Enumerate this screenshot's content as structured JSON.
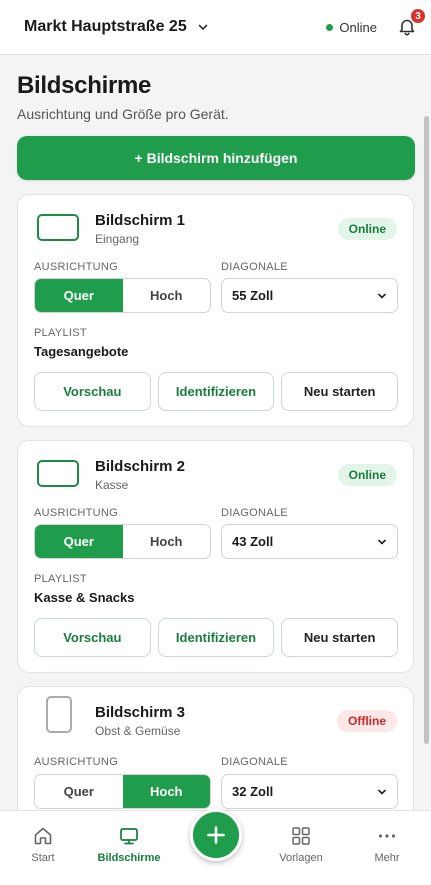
{
  "header": {
    "store_name": "Markt Hauptstraße 25",
    "status_label": "Online",
    "notification_count": "3"
  },
  "page": {
    "title": "Bildschirme",
    "subtitle": "Ausrichtung und Größe pro Gerät.",
    "add_button_label": "+ Bildschirm hinzufügen"
  },
  "labels": {
    "orientation": "AUSRICHTUNG",
    "diagonal": "DIAGONALE",
    "playlist": "PLAYLIST",
    "landscape": "Quer",
    "portrait": "Hoch",
    "preview": "Vorschau",
    "identify": "Identifizieren",
    "restart": "Neu starten"
  },
  "screens": [
    {
      "name": "Bildschirm 1",
      "location": "Eingang",
      "status": "Online",
      "orientation": "Quer",
      "diagonal": "55 Zoll",
      "playlist": "Tagesangebote"
    },
    {
      "name": "Bildschirm 2",
      "location": "Kasse",
      "status": "Online",
      "orientation": "Quer",
      "diagonal": "43 Zoll",
      "playlist": "Kasse & Snacks"
    },
    {
      "name": "Bildschirm 3",
      "location": "Obst & Gemüse",
      "status": "Offline",
      "orientation": "Hoch",
      "diagonal": "32 Zoll",
      "playlist": ""
    }
  ],
  "bottom_nav": {
    "items": [
      {
        "label": "Start",
        "icon": "home-icon"
      },
      {
        "label": "Bildschirme",
        "icon": "monitor-icon"
      },
      {
        "label": "Vorlagen",
        "icon": "grid-icon"
      },
      {
        "label": "Mehr",
        "icon": "more-icon"
      }
    ],
    "fab_icon": "plus-icon"
  },
  "colors": {
    "accent": "#1f9d4c",
    "online_pill_bg": "#e3f4e8",
    "online_pill_text": "#1a7d3f",
    "offline_pill_bg": "#fde7e7",
    "offline_pill_text": "#cc2a2a",
    "badge": "#d9302c"
  }
}
